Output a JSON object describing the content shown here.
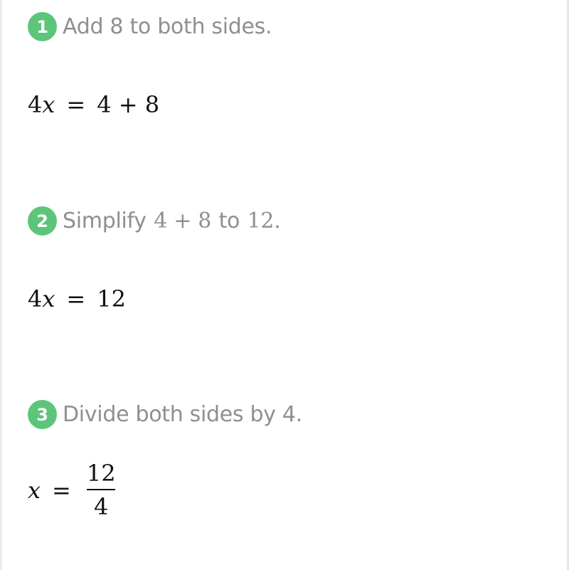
{
  "colors": {
    "badge": "#5cc57a",
    "step_text": "#8f8f8f",
    "math_text": "#111111"
  },
  "steps": [
    {
      "number": "1",
      "text_before": "Add 8 to both sides.",
      "equation": {
        "lhs_coef": "4",
        "lhs_var": "x",
        "eq": "=",
        "rhs": "4 + 8"
      }
    },
    {
      "number": "2",
      "text_before": "Simplify",
      "math_a": "4 + 8",
      "text_mid": "to",
      "math_b": "12.",
      "equation": {
        "lhs_coef": "4",
        "lhs_var": "x",
        "eq": "=",
        "rhs": "12"
      }
    },
    {
      "number": "3",
      "text_before": "Divide both sides by 4.",
      "equation": {
        "lhs_var": "x",
        "eq": "=",
        "numerator": "12",
        "denominator": "4"
      }
    }
  ]
}
